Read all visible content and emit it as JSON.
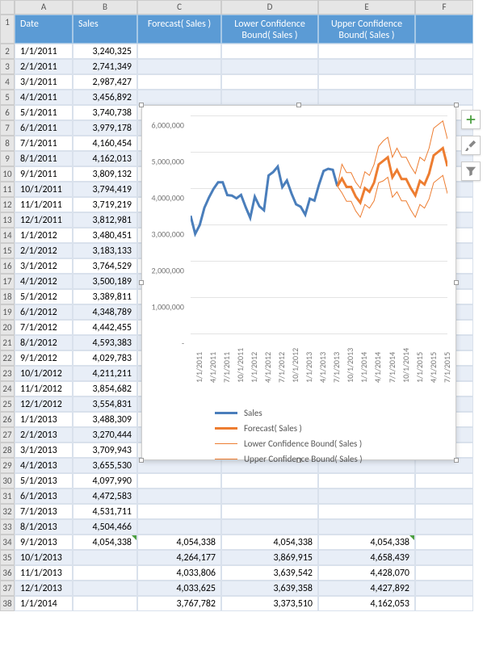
{
  "columns": {
    "row_header": "",
    "A": "A",
    "B": "B",
    "C": "C",
    "D": "D",
    "E": "E",
    "F": "F"
  },
  "headers": {
    "date": "Date",
    "sales": "Sales",
    "forecast": "Forecast( Sales )",
    "lower": "Lower Confidence Bound( Sales )",
    "upper": "Upper Confidence Bound( Sales )"
  },
  "rows": [
    {
      "n": "1"
    },
    {
      "n": "2",
      "date": "1/1/2011",
      "sales": "3,240,325"
    },
    {
      "n": "3",
      "date": "2/1/2011",
      "sales": "2,741,349"
    },
    {
      "n": "4",
      "date": "3/1/2011",
      "sales": "2,987,427"
    },
    {
      "n": "5",
      "date": "4/1/2011",
      "sales": "3,456,892"
    },
    {
      "n": "6",
      "date": "5/1/2011",
      "sales": "3,740,738"
    },
    {
      "n": "7",
      "date": "6/1/2011",
      "sales": "3,979,178"
    },
    {
      "n": "8",
      "date": "7/1/2011",
      "sales": "4,160,454"
    },
    {
      "n": "9",
      "date": "8/1/2011",
      "sales": "4,162,013"
    },
    {
      "n": "10",
      "date": "9/1/2011",
      "sales": "3,809,132"
    },
    {
      "n": "11",
      "date": "10/1/2011",
      "sales": "3,794,419"
    },
    {
      "n": "12",
      "date": "11/1/2011",
      "sales": "3,719,219"
    },
    {
      "n": "13",
      "date": "12/1/2011",
      "sales": "3,812,981"
    },
    {
      "n": "14",
      "date": "1/1/2012",
      "sales": "3,480,451"
    },
    {
      "n": "15",
      "date": "2/1/2012",
      "sales": "3,183,133"
    },
    {
      "n": "16",
      "date": "3/1/2012",
      "sales": "3,764,529"
    },
    {
      "n": "17",
      "date": "4/1/2012",
      "sales": "3,500,189"
    },
    {
      "n": "18",
      "date": "5/1/2012",
      "sales": "3,389,811"
    },
    {
      "n": "19",
      "date": "6/1/2012",
      "sales": "4,348,789"
    },
    {
      "n": "20",
      "date": "7/1/2012",
      "sales": "4,442,455"
    },
    {
      "n": "21",
      "date": "8/1/2012",
      "sales": "4,593,383"
    },
    {
      "n": "22",
      "date": "9/1/2012",
      "sales": "4,029,783"
    },
    {
      "n": "23",
      "date": "10/1/2012",
      "sales": "4,211,211"
    },
    {
      "n": "24",
      "date": "11/1/2012",
      "sales": "3,854,682"
    },
    {
      "n": "25",
      "date": "12/1/2012",
      "sales": "3,554,831"
    },
    {
      "n": "26",
      "date": "1/1/2013",
      "sales": "3,488,309"
    },
    {
      "n": "27",
      "date": "2/1/2013",
      "sales": "3,270,444"
    },
    {
      "n": "28",
      "date": "3/1/2013",
      "sales": "3,709,943"
    },
    {
      "n": "29",
      "date": "4/1/2013",
      "sales": "3,655,530"
    },
    {
      "n": "30",
      "date": "5/1/2013",
      "sales": "4,097,990"
    },
    {
      "n": "31",
      "date": "6/1/2013",
      "sales": "4,472,583"
    },
    {
      "n": "32",
      "date": "7/1/2013",
      "sales": "4,531,711"
    },
    {
      "n": "33",
      "date": "8/1/2013",
      "sales": "4,504,466"
    },
    {
      "n": "34",
      "date": "9/1/2013",
      "sales": "4,054,338",
      "forecast": "4,054,338",
      "lower": "4,054,338",
      "upper": "4,054,338",
      "mark": true
    },
    {
      "n": "35",
      "date": "10/1/2013",
      "forecast": "4,264,177",
      "lower": "3,869,915",
      "upper": "4,658,439"
    },
    {
      "n": "36",
      "date": "11/1/2013",
      "forecast": "4,033,806",
      "lower": "3,639,542",
      "upper": "4,428,070"
    },
    {
      "n": "37",
      "date": "12/1/2013",
      "forecast": "4,033,625",
      "lower": "3,639,358",
      "upper": "4,427,892"
    },
    {
      "n": "38",
      "date": "1/1/2014",
      "forecast": "3,767,782",
      "lower": "3,373,510",
      "upper": "4,162,053"
    }
  ],
  "chart_data": {
    "type": "line",
    "title": "",
    "xlabel": "",
    "ylabel": "",
    "ylim": [
      0,
      6000000
    ],
    "y_ticks": [
      "-",
      "1,000,000",
      "2,000,000",
      "3,000,000",
      "4,000,000",
      "5,000,000",
      "6,000,000"
    ],
    "x_ticks": [
      "1/1/2011",
      "4/1/2011",
      "7/1/2011",
      "10/1/2011",
      "1/1/2012",
      "4/1/2012",
      "7/1/2012",
      "10/1/2012",
      "1/1/2013",
      "4/1/2013",
      "7/1/2013",
      "10/1/2013",
      "1/1/2014",
      "4/1/2014",
      "7/1/2014",
      "10/1/2014",
      "1/1/2015",
      "4/1/2015",
      "7/1/2015"
    ],
    "series": [
      {
        "name": "Sales",
        "color": "#4a7ebb",
        "width": 3,
        "x": [
          "1/1/2011",
          "2/1/2011",
          "3/1/2011",
          "4/1/2011",
          "5/1/2011",
          "6/1/2011",
          "7/1/2011",
          "8/1/2011",
          "9/1/2011",
          "10/1/2011",
          "11/1/2011",
          "12/1/2011",
          "1/1/2012",
          "2/1/2012",
          "3/1/2012",
          "4/1/2012",
          "5/1/2012",
          "6/1/2012",
          "7/1/2012",
          "8/1/2012",
          "9/1/2012",
          "10/1/2012",
          "11/1/2012",
          "12/1/2012",
          "1/1/2013",
          "2/1/2013",
          "3/1/2013",
          "4/1/2013",
          "5/1/2013",
          "6/1/2013",
          "7/1/2013",
          "8/1/2013",
          "9/1/2013"
        ],
        "values": [
          3240325,
          2741349,
          2987427,
          3456892,
          3740738,
          3979178,
          4160454,
          4162013,
          3809132,
          3794419,
          3719219,
          3812981,
          3480451,
          3183133,
          3764529,
          3500189,
          3389811,
          4348789,
          4442455,
          4593383,
          4029783,
          4211211,
          3854682,
          3554831,
          3488309,
          3270444,
          3709943,
          3655530,
          4097990,
          4472583,
          4531711,
          4504466,
          4054338
        ]
      },
      {
        "name": "Forecast( Sales )",
        "color": "#ed7d31",
        "width": 3,
        "x": [
          "9/1/2013",
          "10/1/2013",
          "11/1/2013",
          "12/1/2013",
          "1/1/2014",
          "2/1/2014",
          "3/1/2014",
          "4/1/2014",
          "5/1/2014",
          "6/1/2014",
          "7/1/2014",
          "8/1/2014",
          "9/1/2014",
          "10/1/2014",
          "11/1/2014",
          "12/1/2014",
          "1/1/2015",
          "2/1/2015",
          "3/1/2015",
          "4/1/2015",
          "5/1/2015",
          "6/1/2015",
          "7/1/2015",
          "8/1/2015",
          "9/1/2015"
        ],
        "values": [
          4054338,
          4264177,
          4033806,
          4033625,
          3767782,
          3600000,
          4000000,
          3900000,
          4150000,
          4650000,
          4750000,
          4850000,
          4300000,
          4500000,
          4250000,
          4250000,
          4000000,
          3800000,
          4200000,
          4100000,
          4400000,
          4900000,
          5000000,
          5100000,
          4600000
        ]
      },
      {
        "name": "Lower Confidence Bound( Sales )",
        "color": "#ed7d31",
        "width": 1,
        "x": [
          "9/1/2013",
          "10/1/2013",
          "11/1/2013",
          "12/1/2013",
          "1/1/2014",
          "2/1/2014",
          "3/1/2014",
          "4/1/2014",
          "5/1/2014",
          "6/1/2014",
          "7/1/2014",
          "8/1/2014",
          "9/1/2014",
          "10/1/2014",
          "11/1/2014",
          "12/1/2014",
          "1/1/2015",
          "2/1/2015",
          "3/1/2015",
          "4/1/2015",
          "5/1/2015",
          "6/1/2015",
          "7/1/2015",
          "8/1/2015",
          "9/1/2015"
        ],
        "values": [
          4054338,
          3869915,
          3639542,
          3639358,
          3373510,
          3200000,
          3550000,
          3450000,
          3650000,
          4150000,
          4200000,
          4300000,
          3750000,
          3900000,
          3650000,
          3650000,
          3400000,
          3200000,
          3550000,
          3450000,
          3700000,
          4150000,
          4250000,
          4350000,
          3850000
        ]
      },
      {
        "name": "Upper Confidence Bound( Sales )",
        "color": "#ed7d31",
        "width": 1,
        "x": [
          "9/1/2013",
          "10/1/2013",
          "11/1/2013",
          "12/1/2013",
          "1/1/2014",
          "2/1/2014",
          "3/1/2014",
          "4/1/2014",
          "5/1/2014",
          "6/1/2014",
          "7/1/2014",
          "8/1/2014",
          "9/1/2014",
          "10/1/2014",
          "11/1/2014",
          "12/1/2014",
          "1/1/2015",
          "2/1/2015",
          "3/1/2015",
          "4/1/2015",
          "5/1/2015",
          "6/1/2015",
          "7/1/2015",
          "8/1/2015",
          "9/1/2015"
        ],
        "values": [
          4054338,
          4658439,
          4428070,
          4427892,
          4162053,
          4000000,
          4450000,
          4350000,
          4650000,
          5150000,
          5300000,
          5400000,
          4850000,
          5100000,
          4850000,
          4850000,
          4600000,
          4400000,
          4850000,
          4750000,
          5100000,
          5650000,
          5750000,
          5850000,
          5350000
        ]
      }
    ],
    "legend": [
      "Sales",
      "Forecast( Sales )",
      "Lower Confidence Bound( Sales )",
      "Upper Confidence Bound( Sales )"
    ]
  }
}
